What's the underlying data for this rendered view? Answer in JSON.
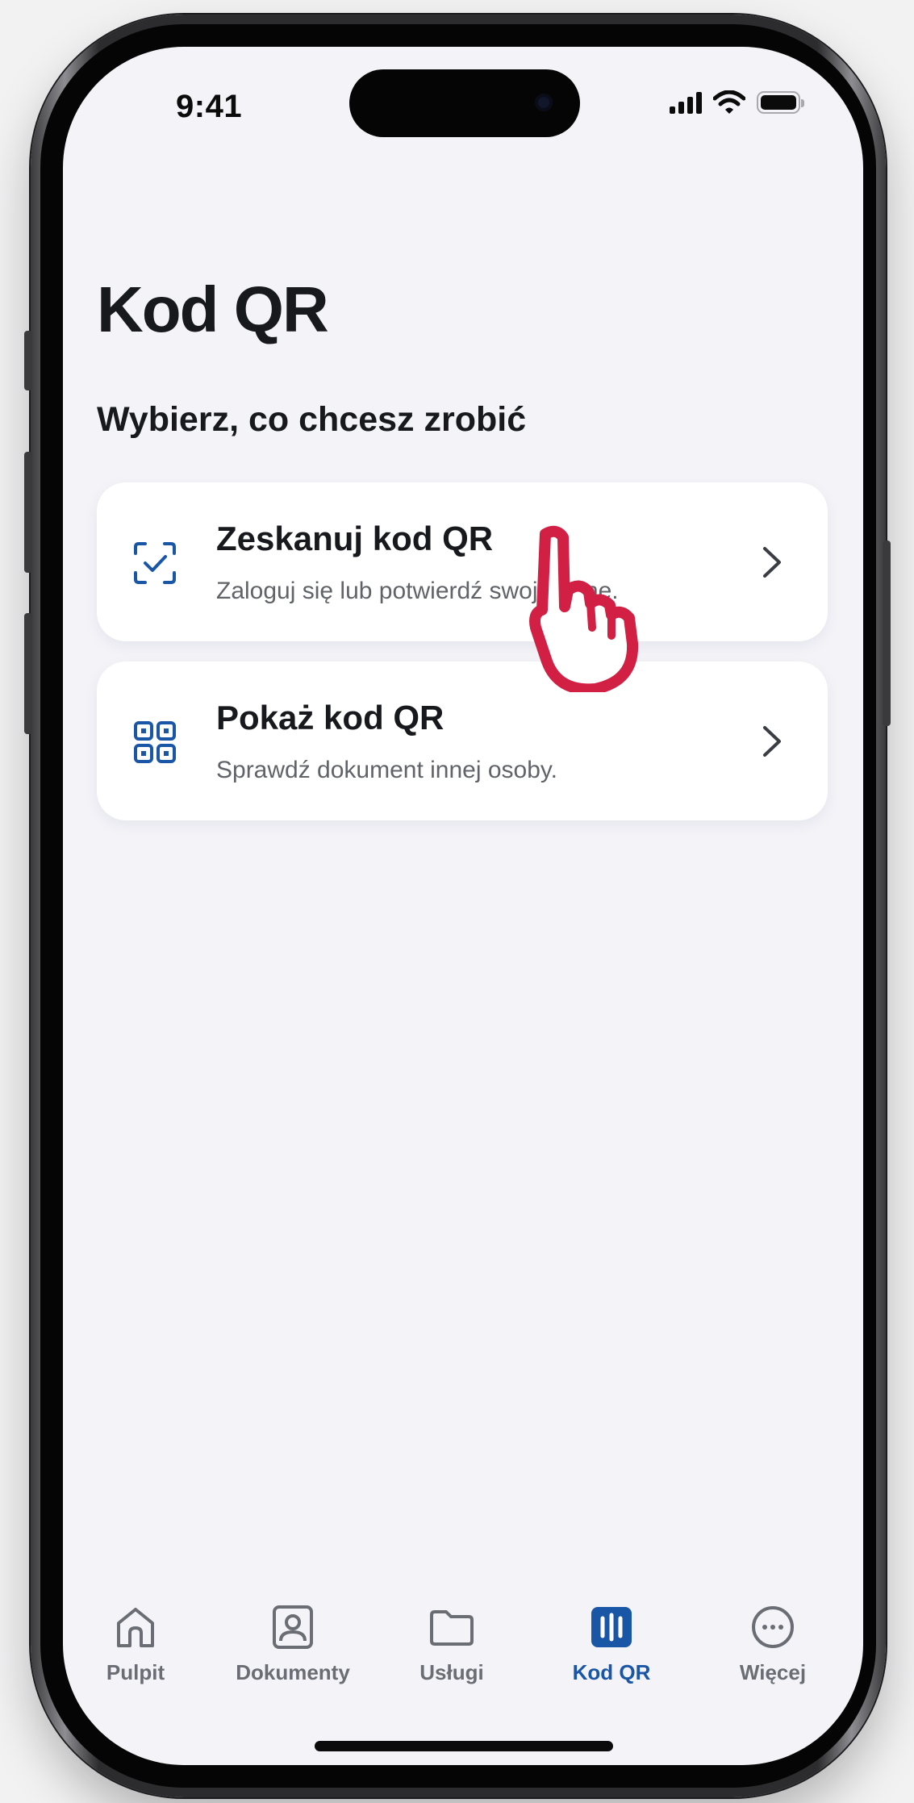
{
  "status_bar": {
    "time": "9:41"
  },
  "page": {
    "title": "Kod QR",
    "section_label": "Wybierz, co chcesz zrobić"
  },
  "options": [
    {
      "title": "Zeskanuj kod QR",
      "subtitle": "Zaloguj się lub potwierdź swoje dane.",
      "icon": "scan-check-icon"
    },
    {
      "title": "Pokaż kod QR",
      "subtitle": "Sprawdź dokument innej osoby.",
      "icon": "qr-code-icon"
    }
  ],
  "tabbar": {
    "items": [
      {
        "label": "Pulpit",
        "icon": "home-icon",
        "active": false
      },
      {
        "label": "Dokumenty",
        "icon": "id-card-icon",
        "active": false
      },
      {
        "label": "Usługi",
        "icon": "folder-icon",
        "active": false
      },
      {
        "label": "Kod QR",
        "icon": "qr-tab-icon",
        "active": true
      },
      {
        "label": "Więcej",
        "icon": "more-icon",
        "active": false
      }
    ]
  },
  "colors": {
    "accent": "#1a56a6",
    "pointer": "#d21f44",
    "background": "#f3f3f8",
    "card": "#ffffff",
    "text_primary": "#17191c",
    "text_secondary": "#606368"
  }
}
